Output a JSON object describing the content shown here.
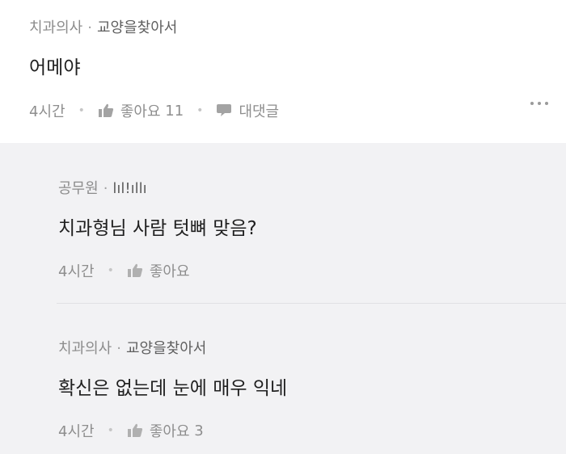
{
  "comment": {
    "author": "치과의사",
    "board": "교양을찾아서",
    "text": "어메야",
    "time": "4시간",
    "like_label": "좋아요",
    "like_count": "11",
    "reply_label": "대댓글"
  },
  "replies": [
    {
      "author": "공무원",
      "board": "lıl!ıllı",
      "text": "치과형님 사람 텃뼈 맞음?",
      "time": "4시간",
      "like_label": "좋아요",
      "like_count": ""
    },
    {
      "author": "치과의사",
      "board": "교양을찾아서",
      "text": "확신은 없는데 눈에 매우 익네",
      "time": "4시간",
      "like_label": "좋아요",
      "like_count": "3"
    }
  ],
  "separator": "·",
  "colors": {
    "reply_background": "#f2f2f4",
    "meta_text": "#8c8c8c"
  },
  "icons": [
    "thumbs-up-icon",
    "speech-bubble-icon",
    "more-dots-icon"
  ]
}
